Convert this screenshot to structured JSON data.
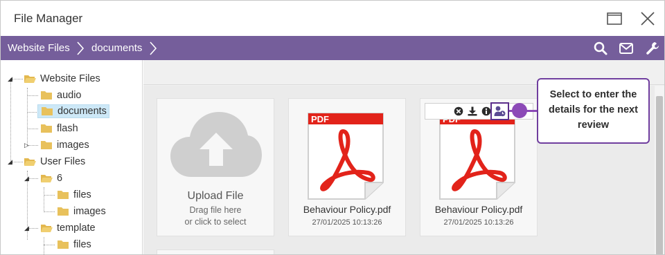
{
  "window": {
    "title": "File Manager",
    "maximize_icon": "maximize-icon",
    "close_icon": "close-icon"
  },
  "breadcrumbs": [
    {
      "label": "Website Files"
    },
    {
      "label": "documents"
    }
  ],
  "toolbar": {
    "search_icon": "search-icon",
    "mail_icon": "envelope-icon",
    "settings_icon": "wrench-icon"
  },
  "tree": {
    "website_files": "Website Files",
    "audio": "audio",
    "documents": "documents",
    "flash": "flash",
    "images": "images",
    "user_files": "User Files",
    "user6": "6",
    "user6_files": "files",
    "user6_images": "images",
    "template": "template",
    "template_files": "files"
  },
  "upload": {
    "title": "Upload File",
    "line1": "Drag file here",
    "line2": "or click to select",
    "icon": "cloud-upload-icon"
  },
  "files": [
    {
      "name": "Behaviour Policy.pdf",
      "date": "27/01/2025 10:13:26",
      "icon": "pdf-icon"
    },
    {
      "name": "Behaviour Policy.pdf",
      "date": "27/01/2025 10:13:26",
      "icon": "pdf-icon"
    }
  ],
  "file_actions": {
    "delete_icon": "delete-icon",
    "download_icon": "download-icon",
    "info_icon": "info-icon",
    "review_icon": "user-clock-icon"
  },
  "callout": {
    "text": "Select to enter the details for the next review"
  },
  "colors": {
    "header_purple": "#755e9b",
    "highlight_purple": "#5b2d8a",
    "callout_purple": "#8c4ab7",
    "selected_blue": "#cde8f7",
    "pdf_red": "#e2231a"
  }
}
